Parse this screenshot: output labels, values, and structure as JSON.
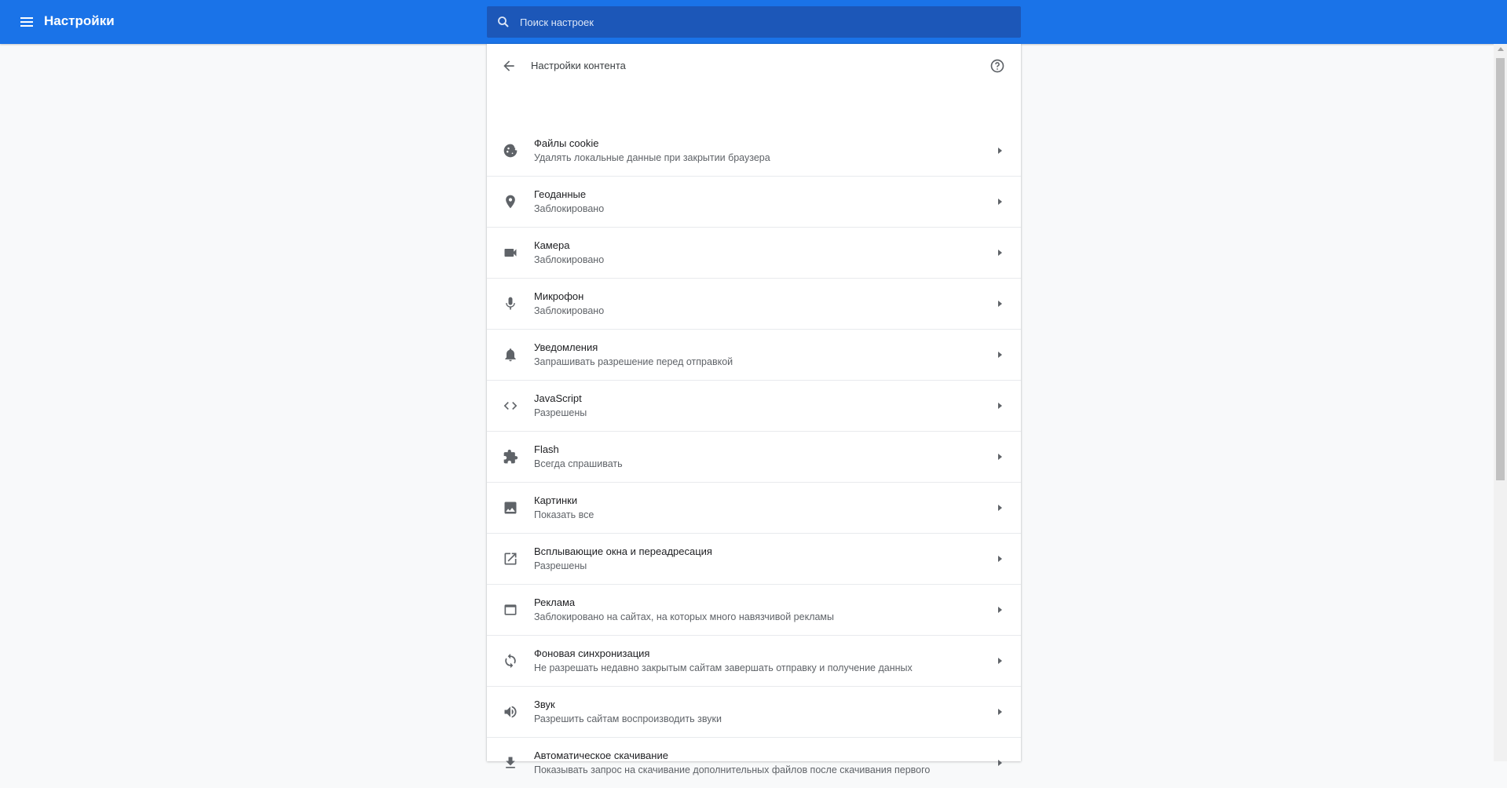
{
  "header": {
    "title": "Настройки",
    "search_placeholder": "Поиск настроек"
  },
  "page": {
    "title": "Настройки контента"
  },
  "items": [
    {
      "icon": "cookie-icon",
      "label": "Файлы cookie",
      "sub": "Удалять локальные данные при закрытии браузера"
    },
    {
      "icon": "location-icon",
      "label": "Геоданные",
      "sub": "Заблокировано"
    },
    {
      "icon": "camera-icon",
      "label": "Камера",
      "sub": "Заблокировано"
    },
    {
      "icon": "microphone-icon",
      "label": "Микрофон",
      "sub": "Заблокировано"
    },
    {
      "icon": "bell-icon",
      "label": "Уведомления",
      "sub": "Запрашивать разрешение перед отправкой"
    },
    {
      "icon": "code-icon",
      "label": "JavaScript",
      "sub": "Разрешены"
    },
    {
      "icon": "puzzle-icon",
      "label": "Flash",
      "sub": "Всегда спрашивать"
    },
    {
      "icon": "image-icon",
      "label": "Картинки",
      "sub": "Показать все"
    },
    {
      "icon": "popup-icon",
      "label": "Всплывающие окна и переадресация",
      "sub": "Разрешены"
    },
    {
      "icon": "ads-icon",
      "label": "Реклама",
      "sub": "Заблокировано на сайтах, на которых много навязчивой рекламы"
    },
    {
      "icon": "sync-icon",
      "label": "Фоновая синхронизация",
      "sub": "Не разрешать недавно закрытым сайтам завершать отправку и получение данных"
    },
    {
      "icon": "volume-icon",
      "label": "Звук",
      "sub": "Разрешить сайтам воспроизводить звуки"
    },
    {
      "icon": "download-icon",
      "label": "Автоматическое скачивание",
      "sub": "Показывать запрос на скачивание дополнительных файлов после скачивания первого"
    }
  ],
  "colors": {
    "accent": "#1a73e8",
    "search_bg": "#1c57b8",
    "icon": "#5f6368",
    "background": "#f8f9fa"
  }
}
